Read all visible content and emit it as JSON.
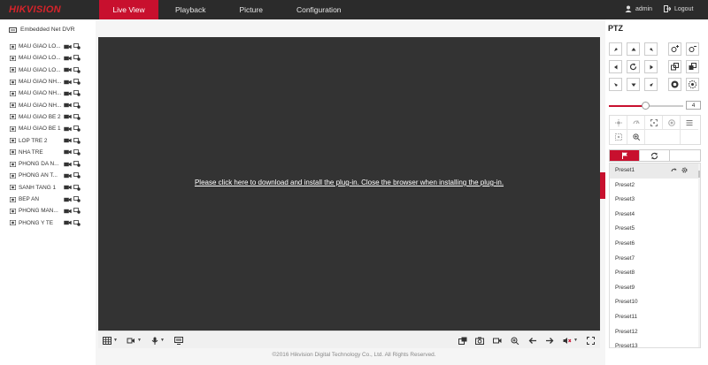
{
  "brand": {
    "logo": "HIKVISION",
    "accent": "#c8102e"
  },
  "nav": {
    "items": [
      {
        "label": "Live View",
        "active": true
      },
      {
        "label": "Playback"
      },
      {
        "label": "Picture"
      },
      {
        "label": "Configuration"
      }
    ]
  },
  "user": {
    "name": "admin",
    "logout_label": "Logout"
  },
  "device": {
    "name": "Embedded Net DVR"
  },
  "channels": [
    "MAU GIAO LO...",
    "MAU GIAO LO...",
    "MAU GIAO LO...",
    "MAU GIAO NH...",
    "MAU GIAO NH...",
    "MAU GIAO NH...",
    "MAU GIAO BE 2",
    "MAU GIAO BE 1",
    "LOP TRE 2",
    "NHA TRE",
    "PHONG DA N...",
    "PHONG AN T...",
    "SANH TANG 1",
    "BEP AN",
    "PHONG MAN...",
    "PHONG Y TE"
  ],
  "video": {
    "plugin_message": "Please click here to download and install the plug-in. Close the browser when installing the plug-in."
  },
  "footer": {
    "copyright": "©2016 Hikvision Digital Technology Co., Ltd. All Rights Reserved."
  },
  "ptz": {
    "title": "PTZ",
    "speed": "4",
    "speed_level": 0.5,
    "presets": [
      "Preset1",
      "Preset2",
      "Preset3",
      "Preset4",
      "Preset5",
      "Preset6",
      "Preset7",
      "Preset8",
      "Preset9",
      "Preset10",
      "Preset11",
      "Preset12",
      "Preset13"
    ]
  }
}
